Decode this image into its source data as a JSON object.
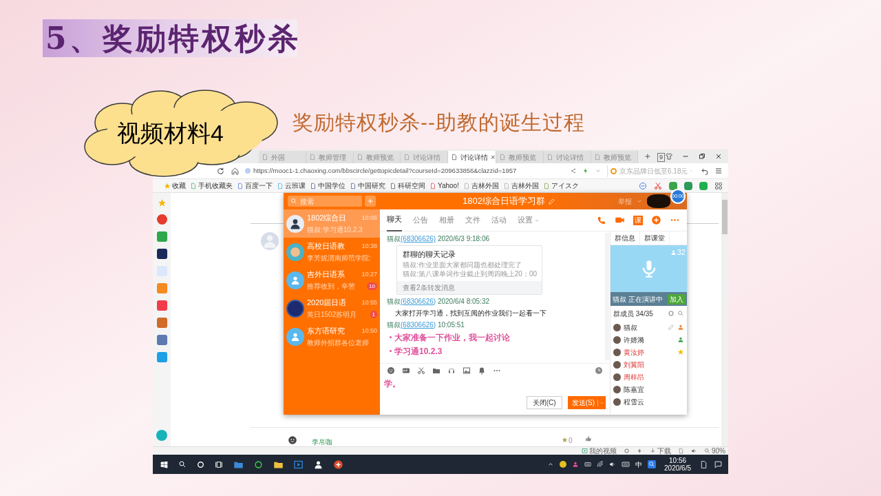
{
  "slide": {
    "title": "5、奖励特权秒杀",
    "badge": "视频材料4",
    "subtitle": "奖励特权秒杀--助教的诞生过程"
  },
  "browser": {
    "tabs": [
      {
        "label": "外国",
        "selected": false
      },
      {
        "label": "教师管理",
        "selected": false
      },
      {
        "label": "教师预览",
        "selected": false
      },
      {
        "label": "讨论详情",
        "selected": false
      },
      {
        "label": "讨论详情",
        "selected": true
      },
      {
        "label": "教师预览",
        "selected": false
      },
      {
        "label": "讨论详情",
        "selected": false
      },
      {
        "label": "教师预览",
        "selected": false
      }
    ],
    "tab_close": "×",
    "tab_count": "9",
    "url": "https://mooc1-1.chaoxing.com/bbscircle/gettopicdetail?courseId=209633856&clazzid=1957",
    "search_placeholder": "京东品牌日低至6.18元",
    "bookmarks": [
      "收藏",
      "手机收藏夹",
      "百度一下",
      "云班课",
      "中国学位",
      "中国研究",
      "科研空间",
      "Yahoo!",
      "吉林外国",
      "吉林外国",
      "アイスク"
    ],
    "page": {
      "author": "李帛咖",
      "likes": "0"
    },
    "status": {
      "video": "我的视频",
      "download": "下载",
      "zoom": "90%"
    }
  },
  "qq": {
    "search_placeholder": "搜索",
    "title": "1802综合日语学习群",
    "report": "举报",
    "timer": "00:00",
    "conversations": [
      {
        "kind": "boy",
        "name": "1802综合日",
        "time": "10:06",
        "preview": "猫叔:学习通10.2.3",
        "selected": true
      },
      {
        "kind": "handshake",
        "name": "高校日语教",
        "time": "10:38",
        "preview": "李芳妮渭南师范学院:",
        "selected": false
      },
      {
        "kind": "id-card",
        "name": "吉外日语系",
        "time": "10:27",
        "preview": "推荐收到，辛苦",
        "unread": "10",
        "selected": false
      },
      {
        "kind": "emblem",
        "name": "2020届日语",
        "time": "10:55",
        "preview": "英日1502苏明月",
        "unread": "1",
        "selected": false
      },
      {
        "kind": "id-card",
        "name": "东方语研究",
        "time": "10:50",
        "preview": "教师外招群各位老师",
        "selected": false
      }
    ],
    "chat_tabs": [
      {
        "label": "聊天",
        "selected": true
      },
      {
        "label": "公告",
        "selected": false
      },
      {
        "label": "相册",
        "selected": false
      },
      {
        "label": "文件",
        "selected": false
      },
      {
        "label": "活动",
        "selected": false
      },
      {
        "label": "设置",
        "selected": false
      }
    ],
    "lesson_label": "课",
    "messages": [
      {
        "kind": "header",
        "sender": "猫叔",
        "id": "(68306626)",
        "time": "2020/6/3 9:18:06"
      },
      {
        "kind": "card",
        "title": "群聊的聊天记录",
        "lines": [
          "猫叔:作业里面大家都问题也都处理完了",
          "猫叔:第八课单词作业截止到周四晚上20：00"
        ],
        "footer": "查看2条转发消息"
      },
      {
        "kind": "header",
        "sender": "猫叔",
        "id": "(68306626)",
        "time": "2020/6/4 8:05:32"
      },
      {
        "kind": "text",
        "text": "大家打开学习通，找到互阅的作业我们一起看一下"
      },
      {
        "kind": "header",
        "sender": "猫叔",
        "id": "(68306626)",
        "time": "10:05:51"
      },
      {
        "kind": "bullet",
        "text": "大家准备一下作业，我一起讨论"
      },
      {
        "kind": "bullet",
        "text": "学习通10.2.3"
      }
    ],
    "input": "学。",
    "close_button": "关闭(C)",
    "send_button": "发送(S)",
    "panel_tabs": [
      "群信息",
      "群课堂"
    ],
    "voice_count": "32",
    "speaking": "猫叔 正在演讲中",
    "join": "加入",
    "members_title": "群成员 34/35",
    "members": [
      {
        "kind": "owner",
        "name": "猫叔",
        "highlighted": false
      },
      {
        "kind": "admin",
        "name": "许婧漪",
        "highlighted": false
      },
      {
        "kind": "starred",
        "name": "黄汝婷",
        "highlighted": true
      },
      {
        "kind": "plain",
        "name": "刘翼阳",
        "highlighted": true
      },
      {
        "kind": "plain",
        "name": "周梓昂",
        "highlighted": true
      },
      {
        "kind": "plain",
        "name": "陈嘉宜",
        "highlighted": false
      },
      {
        "kind": "plain",
        "name": "程雪云",
        "highlighted": false
      }
    ]
  },
  "taskbar": {
    "ime": "中",
    "time": "10:56",
    "date": "2020/6/5"
  }
}
